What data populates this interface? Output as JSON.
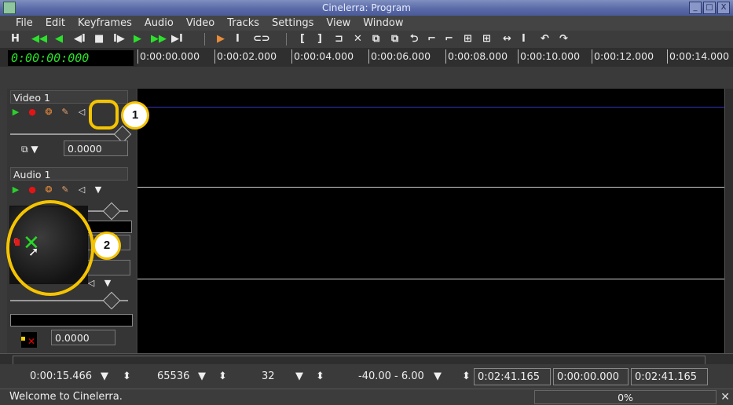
{
  "window": {
    "title": "Cinelerra: Program",
    "min_glyph": "_",
    "max_glyph": "□",
    "close_glyph": "X"
  },
  "menu": [
    "File",
    "Edit",
    "Keyframes",
    "Audio",
    "Video",
    "Tracks",
    "Settings",
    "View",
    "Window"
  ],
  "transport": [
    "H",
    "◀◀",
    "◀",
    "◀I",
    "■",
    "I▶",
    "▶",
    "▶▶",
    "▶I"
  ],
  "edit_tools": [
    "▶",
    "I",
    "⊂⊃"
  ],
  "edit_buttons": [
    "[",
    "]",
    "⊐",
    "✕",
    "⧉",
    "⧉",
    "⮌",
    "⌐",
    "⌐",
    "⊞",
    "⊞",
    "↔",
    "I",
    "↶",
    "↷"
  ],
  "clock": "0:00:00:000",
  "ruler": [
    "0:00:00.000",
    "0:00:02.000",
    "0:00:04.000",
    "0:00:06.000",
    "0:00:08.000",
    "0:00:10.000",
    "0:00:12.000",
    "0:00:14.000"
  ],
  "tracks": {
    "video": {
      "title": "Video 1",
      "value": "0.0000",
      "mode_icon": "⧉ ▼"
    },
    "audio": {
      "title": "Audio 1",
      "pan_value": "0.0000",
      "pan_prefix": "0"
    }
  },
  "patch_icons": {
    "play": "▶",
    "record": "●",
    "gear": "❂",
    "pen": "✎",
    "mute": "◁",
    "expand": "▼"
  },
  "callouts": {
    "one": "1",
    "two": "2"
  },
  "status": {
    "length": "0:00:15.466",
    "sample_rate": "65536",
    "zoom_level": "32",
    "meter_range": "-40.00 - 6.00",
    "sel_start": "0:02:41.165",
    "sel_mid": "0:00:00.000",
    "sel_end": "0:02:41.165",
    "dropdown_glyph": "▼",
    "updown_glyph": "⬍"
  },
  "footer": {
    "welcome": "Welcome to Cinelerra.",
    "progress": "0%",
    "close": "✕"
  },
  "colors": {
    "highlight": "#f5c400",
    "clock_green": "#28e428"
  }
}
